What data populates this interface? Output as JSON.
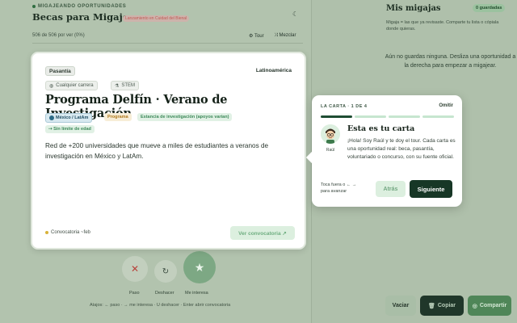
{
  "header": {
    "kicker": "MIGAJEANDO OPORTUNIDADES",
    "title": "Becas para Migajear",
    "countdown": "Lanzamiento en Cuidad del Bienal",
    "counter": "506 de 506 por ver (0%)",
    "tour_label": "Tour",
    "shuffle_label": "Mezclar"
  },
  "panel": {
    "title": "Mis migajas",
    "saved_badge": "0 guardadas",
    "description": "Migaja = las que ya revisaste. Comparte tu lista o cópiala donde quieras.",
    "empty_message": "Aún no guardas ninguna. Desliza una oportunidad a la derecha para empezar a migajear."
  },
  "card": {
    "type": "Pasantía",
    "region": "Latinoamérica",
    "chips": [
      "Cualquier carrera",
      "STEM"
    ],
    "title": "Programa Delfín · Verano de Investigación",
    "badges": {
      "location": "México / LatAm",
      "kind": "Programa",
      "stay": "Estancia de investigación (apoyos varían)",
      "age": "⇢ Sin límite de edad"
    },
    "description": "Red de +200 universidades que mueve a miles de estudiantes a veranos de investigación en México y LatAm.",
    "deadline": "Convocatoria ~feb",
    "view_button": "Ver convocatoria ↗"
  },
  "actions": {
    "pass_label": "Paso",
    "undo_label": "Deshacer",
    "like_label": "Me interesa",
    "hint": "Atajos: ← paso · → me interesa · U deshacer · Enter abrir convocatoria"
  },
  "footer": {
    "clear": "Vaciar",
    "copy": "Copiar",
    "share": "Compartir"
  },
  "tour": {
    "step": "LA CARTA · 1 DE 4",
    "skip": "Omitir",
    "progress": {
      "current": 1,
      "total": 4
    },
    "avatar_name": "Raúl",
    "title": "Esta es tu carta",
    "body": "¡Hola! Soy Raúl y te doy el tour. Cada carta es una oportunidad real: beca, pasantía, voluntariado o concurso, con su fuente oficial.",
    "hint": "Toca fuera o ← → para avanzar",
    "back": "Atrás",
    "next": "Siguiente"
  },
  "colors": {
    "primary_dark": "#173726",
    "accent_green": "#4f8658",
    "pass_red": "#b8433c",
    "backdrop": "#a7b9a4"
  }
}
